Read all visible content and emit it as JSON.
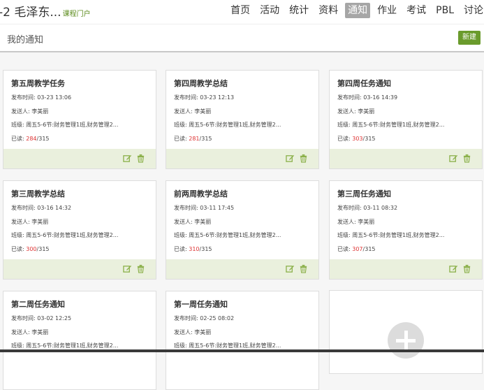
{
  "header": {
    "course_title": "-2 毛泽东...",
    "portal_link": "课程门户",
    "nav": [
      "首页",
      "活动",
      "统计",
      "资料",
      "通知",
      "作业",
      "考试",
      "PBL",
      "讨论"
    ],
    "active_nav": "通知"
  },
  "page": {
    "title": "我的通知",
    "new_button": "新建"
  },
  "labels": {
    "publish_time": "发布时间:",
    "sender": "发送人:",
    "class": "班级:",
    "read": "已读:"
  },
  "notices": [
    {
      "title": "第五周教学任务",
      "time": "03-23 13:06",
      "sender": "李美丽",
      "classes": "周五5-6节:财务管理1班,财务管理2...",
      "read": "284",
      "total": "/315"
    },
    {
      "title": "第四周教学总结",
      "time": "03-23 12:13",
      "sender": "李美丽",
      "classes": "周五5-6节:财务管理1班,财务管理2...",
      "read": "281",
      "total": "/315"
    },
    {
      "title": "第四周任务通知",
      "time": "03-16 14:39",
      "sender": "李美丽",
      "classes": "周五5-6节:财务管理1班,财务管理2...",
      "read": "303",
      "total": "/315"
    },
    {
      "title": "第三周教学总结",
      "time": "03-16 14:32",
      "sender": "李美丽",
      "classes": "周五5-6节:财务管理1班,财务管理2...",
      "read": "300",
      "total": "/315"
    },
    {
      "title": "前两周教学总结",
      "time": "03-11 17:45",
      "sender": "李美丽",
      "classes": "周五5-6节:财务管理1班,财务管理2...",
      "read": "310",
      "total": "/315"
    },
    {
      "title": "第三周任务通知",
      "time": "03-11 08:32",
      "sender": "李美丽",
      "classes": "周五5-6节:财务管理1班,财务管理2...",
      "read": "307",
      "total": "/315"
    },
    {
      "title": "第二周任务通知",
      "time": "03-02 12:25",
      "sender": "李美丽",
      "classes": "周五5-6节:财务管理1班,财务管理2..."
    },
    {
      "title": "第一周任务通知",
      "time": "02-25 08:02",
      "sender": "李美丽",
      "classes": "周五5-6节:财务管理1班,财务管理2..."
    }
  ],
  "colors": {
    "accent": "#6a9b2c",
    "read_count": "#dd3333",
    "footer": "#eaf0dd"
  }
}
